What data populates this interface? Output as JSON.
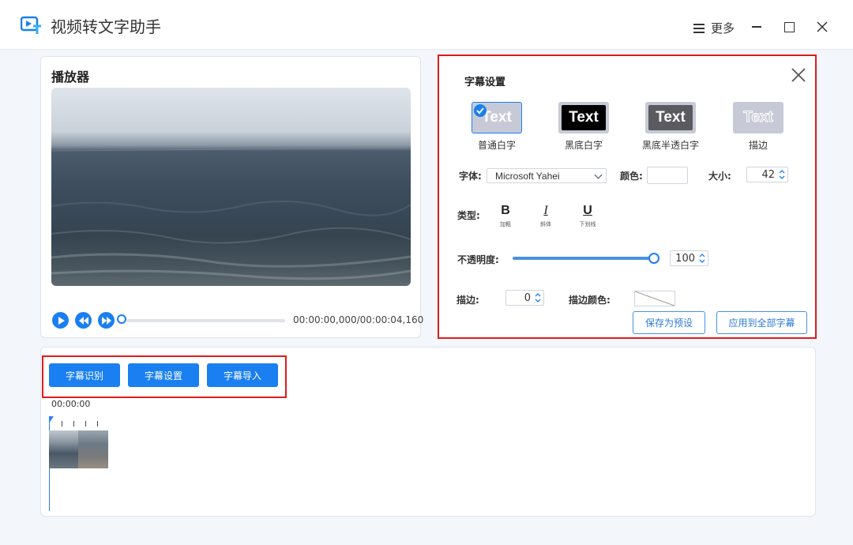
{
  "app": {
    "title": "视频转文字助手"
  },
  "window_controls": {
    "more_label": "更多"
  },
  "player": {
    "title": "播放器",
    "time_display": "00:00:00,000/00:00:04,160",
    "progress": 0
  },
  "subtitle_settings": {
    "title": "字幕设置",
    "preview_text": "Text",
    "styles": [
      {
        "label": "普通白字",
        "selected": true
      },
      {
        "label": "黑底白字",
        "selected": false
      },
      {
        "label": "黑底半透白字",
        "selected": false
      },
      {
        "label": "描边",
        "selected": false
      }
    ],
    "font_label": "字体:",
    "font_value": "Microsoft Yahei",
    "color_label": "颜色:",
    "size_label": "大小:",
    "size_value": "42",
    "type_label": "类型:",
    "formats": [
      {
        "glyph": "B",
        "caption": "加粗"
      },
      {
        "glyph": "I",
        "caption": "斜体"
      },
      {
        "glyph": "U",
        "caption": "下划线"
      }
    ],
    "opacity_label": "不透明度:",
    "opacity_value": "100",
    "stroke_label": "描边:",
    "stroke_value": "0",
    "stroke_color_label": "描边颜色:",
    "save_preset_label": "保存为预设",
    "apply_all_label": "应用到全部字幕"
  },
  "timeline": {
    "buttons": [
      "字幕识别",
      "字幕设置",
      "字幕导入"
    ],
    "time_label": "00:00:00"
  },
  "colors": {
    "accent": "#1a7ff0",
    "highlight_frame": "#e01b1b",
    "background": "#f3f6fb"
  }
}
